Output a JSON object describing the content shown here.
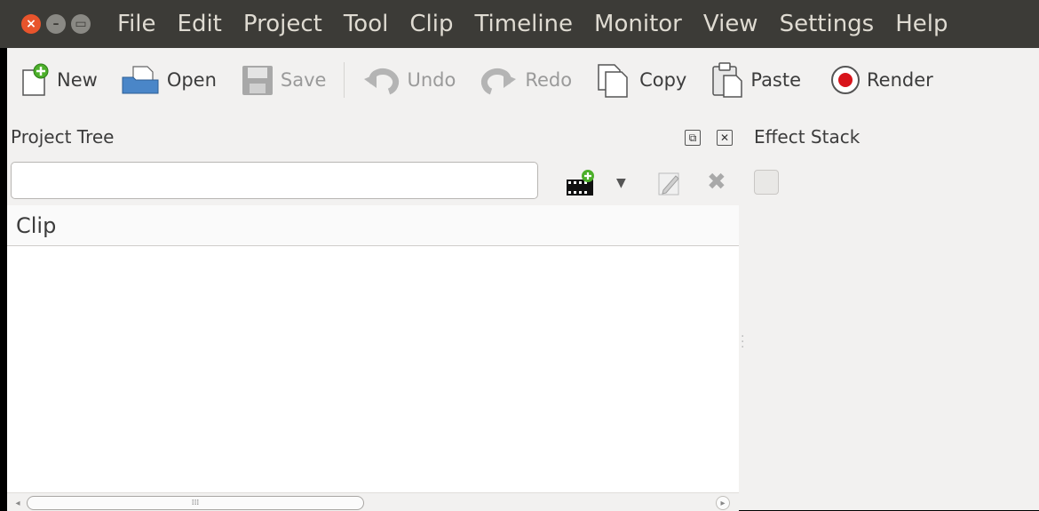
{
  "menubar": {
    "items": [
      "File",
      "Edit",
      "Project",
      "Tool",
      "Clip",
      "Timeline",
      "Monitor",
      "View",
      "Settings",
      "Help"
    ]
  },
  "toolbar": {
    "new_label": "New",
    "open_label": "Open",
    "save_label": "Save",
    "undo_label": "Undo",
    "redo_label": "Redo",
    "copy_label": "Copy",
    "paste_label": "Paste",
    "render_label": "Render"
  },
  "project_tree": {
    "title": "Project Tree",
    "search_value": "",
    "column_header": "Clip"
  },
  "effect_stack": {
    "title": "Effect Stack"
  },
  "colors": {
    "menubar_bg": "#3c3b37",
    "close_button": "#e8542c",
    "render_red": "#d8141b",
    "add_green": "#4caf2a"
  },
  "icons": [
    "close-icon",
    "minimize-icon",
    "maximize-icon",
    "new-document-icon",
    "open-folder-icon",
    "save-icon",
    "undo-icon",
    "redo-icon",
    "copy-icon",
    "paste-icon",
    "render-icon",
    "add-clip-icon",
    "dropdown-arrow-icon",
    "edit-pencil-icon",
    "delete-x-icon"
  ]
}
